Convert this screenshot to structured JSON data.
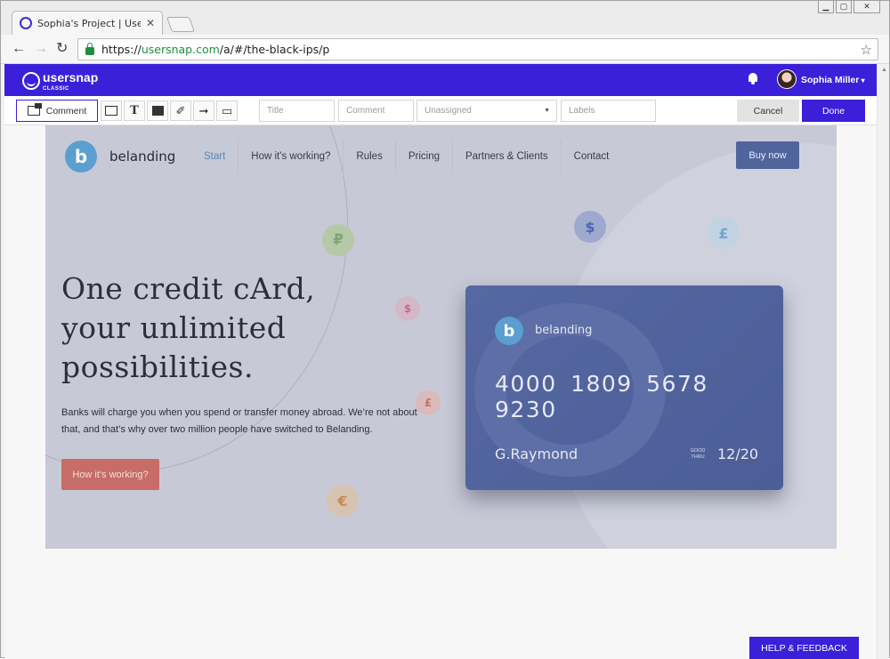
{
  "browser": {
    "tab_title": "Sophia's Project | Usersnap",
    "tab_close": "✕",
    "url_scheme": "https://",
    "url_host": "usersnap.com",
    "url_path": "/a/#/the-black-ips/p",
    "win_minimize": "▁",
    "win_maximize": "▢",
    "win_close": "✕"
  },
  "usersnap": {
    "logo_text": "usersnap",
    "logo_sub": "CLASSIC",
    "user_name": "Sophia Miller",
    "accent_color": "#3b1fd9"
  },
  "annotate": {
    "comment_tool": "Comment",
    "text_tool": "T",
    "title_placeholder": "Title",
    "comment_placeholder": "Comment",
    "assignee_value": "Unassigned",
    "labels_placeholder": "Labels",
    "cancel": "Cancel",
    "done": "Done"
  },
  "site": {
    "brand": "belanding",
    "logo_glyph": "b",
    "nav": [
      "Start",
      "How it's working?",
      "Rules",
      "Pricing",
      "Partners & Clients",
      "Contact"
    ],
    "buy_now": "Buy now",
    "hero_line1": "One credit cArd,",
    "hero_line2": "your unlimited",
    "hero_line3": "possibilities.",
    "hero_text": "Banks will charge you when you spend or transfer money abroad. We’re not about that, and that’s why over two million people have switched to Belanding.",
    "hero_button": "How it's working?",
    "coins": [
      "₽",
      "$",
      "£",
      "$",
      "£",
      "€"
    ]
  },
  "card": {
    "brand": "belanding",
    "number": "4000 1809 5678 9230",
    "holder": "G.Raymond",
    "good_thru": "GOOD THRU",
    "expiry": "12/20"
  },
  "help_button": "HELP & FEEDBACK"
}
